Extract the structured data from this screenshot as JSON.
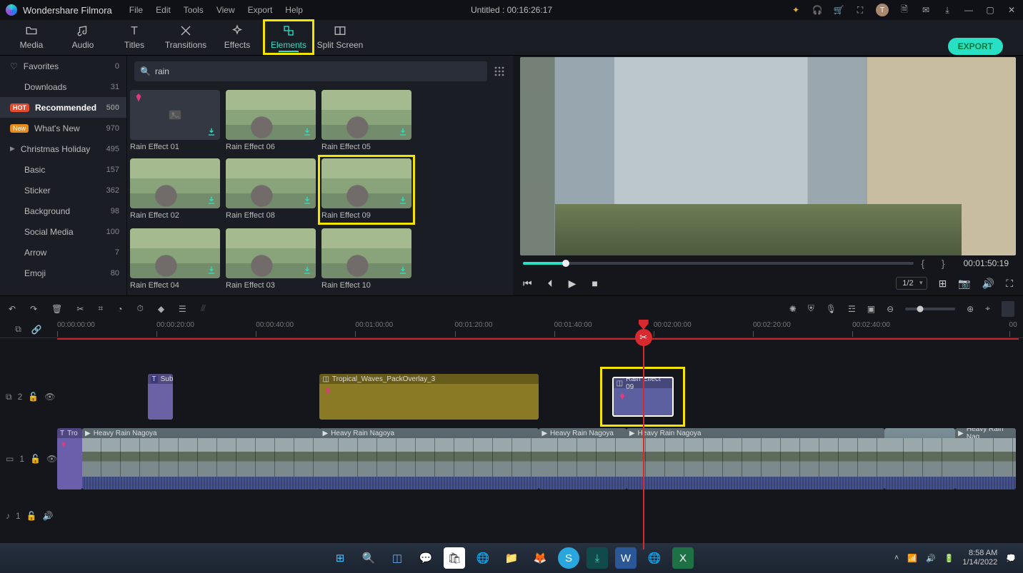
{
  "titlebar": {
    "app_name": "Wondershare Filmora",
    "menus": [
      "File",
      "Edit",
      "Tools",
      "View",
      "Export",
      "Help"
    ],
    "project_title": "Untitled : 00:16:26:17",
    "avatar_letter": "T"
  },
  "main_tabs": {
    "labels": [
      "Media",
      "Audio",
      "Titles",
      "Transitions",
      "Effects",
      "Elements",
      "Split Screen"
    ],
    "active": "Elements",
    "export_label": "EXPORT"
  },
  "sidebar": {
    "items": [
      {
        "label": "Favorites",
        "count": "0",
        "icon": "heart"
      },
      {
        "label": "Downloads",
        "count": "31"
      },
      {
        "label": "Recommended",
        "count": "500",
        "badge": "HOT",
        "active": true
      },
      {
        "label": "What's New",
        "count": "970",
        "badge": "New"
      },
      {
        "label": "Christmas Holiday",
        "count": "495",
        "chev": true
      },
      {
        "label": "Basic",
        "count": "157"
      },
      {
        "label": "Sticker",
        "count": "362"
      },
      {
        "label": "Background",
        "count": "98"
      },
      {
        "label": "Social Media",
        "count": "100"
      },
      {
        "label": "Arrow",
        "count": "7"
      },
      {
        "label": "Emoji",
        "count": "80"
      }
    ]
  },
  "search": {
    "value": "rain"
  },
  "thumbs": [
    {
      "name": "Rain Effect 01",
      "ph": true
    },
    {
      "name": "Rain Effect 06"
    },
    {
      "name": "Rain Effect 05"
    },
    {
      "name": "Rain Effect 02"
    },
    {
      "name": "Rain Effect 08"
    },
    {
      "name": "Rain Effect 09",
      "selected": true,
      "highlight": true
    },
    {
      "name": "Rain Effect 04"
    },
    {
      "name": "Rain Effect 03"
    },
    {
      "name": "Rain Effect 10"
    }
  ],
  "preview": {
    "timecode": "00:01:50:19",
    "page": "1/2"
  },
  "ruler": {
    "ticks": [
      "00:00:00:00",
      "00:00:20:00",
      "00:00:40:00",
      "00:01:00:00",
      "00:01:20:00",
      "00:01:40:00",
      "00:02:00:00",
      "00:02:20:00",
      "00:02:40:00"
    ],
    "end": "00"
  },
  "clips": {
    "sub": "Sub",
    "overlay": "Tropical_Waves_PackOverlay_3",
    "rain": "Rain Effect 09",
    "v1": "Tro",
    "v2": "Heavy Rain Nagoya",
    "v3": "Heavy Rain Nagoya",
    "v4": "Heavy Rain Nagoya",
    "v5": "Heavy Rain Nagoya",
    "v7": "Heavy Rain Nag"
  },
  "tracks": {
    "fx2": "2",
    "vid1": "1",
    "aud": "1"
  },
  "taskbar": {
    "time": "8:58 AM",
    "date": "1/14/2022"
  }
}
